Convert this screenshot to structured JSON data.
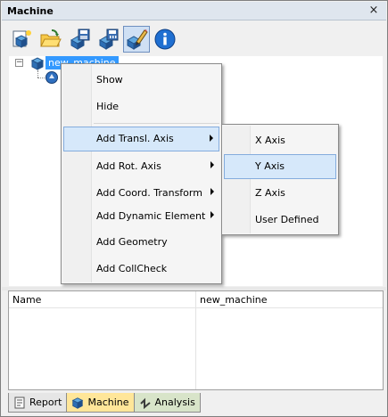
{
  "window": {
    "title": "Machine",
    "close_glyph": "×"
  },
  "toolbar": {
    "buttons": [
      {
        "icon": "new-machine-icon",
        "active": false
      },
      {
        "icon": "open-folder-icon",
        "active": false
      },
      {
        "icon": "save-icon",
        "active": false
      },
      {
        "icon": "save-as-icon",
        "active": false
      },
      {
        "icon": "edit-icon",
        "active": true
      },
      {
        "icon": "info-icon",
        "active": false
      }
    ]
  },
  "tree": {
    "root_label": "new_machine",
    "expander_glyph": "−"
  },
  "context_menu": {
    "items": [
      {
        "label": "Show",
        "has_submenu": false,
        "highlighted": false
      },
      {
        "label": "Hide",
        "has_submenu": false,
        "highlighted": false
      },
      {
        "label": "Add Transl. Axis",
        "has_submenu": true,
        "highlighted": true
      },
      {
        "label": "Add Rot. Axis",
        "has_submenu": true,
        "highlighted": false
      },
      {
        "label": "Add Coord. Transform",
        "has_submenu": true,
        "highlighted": false
      },
      {
        "label": "Add Dynamic Element",
        "has_submenu": true,
        "highlighted": false
      },
      {
        "label": "Add Geometry",
        "has_submenu": false,
        "highlighted": false
      },
      {
        "label": "Add CollCheck",
        "has_submenu": false,
        "highlighted": false
      }
    ]
  },
  "submenu": {
    "items": [
      {
        "label": "X Axis",
        "highlighted": false
      },
      {
        "label": "Y Axis",
        "highlighted": true
      },
      {
        "label": "Z Axis",
        "highlighted": false
      },
      {
        "label": "User Defined",
        "highlighted": false
      }
    ]
  },
  "properties": {
    "name_label": "Name",
    "name_value": "new_machine"
  },
  "tabs": [
    {
      "label": "Report",
      "icon": "report-icon",
      "selected": false
    },
    {
      "label": "Machine",
      "icon": "machine-icon",
      "selected": true
    },
    {
      "label": "Analysis",
      "icon": "analysis-icon",
      "selected": false
    }
  ],
  "colors": {
    "selection": "#3399ff",
    "menu_highlight": "#d6e8fa",
    "active_tab": "#ffe699"
  }
}
